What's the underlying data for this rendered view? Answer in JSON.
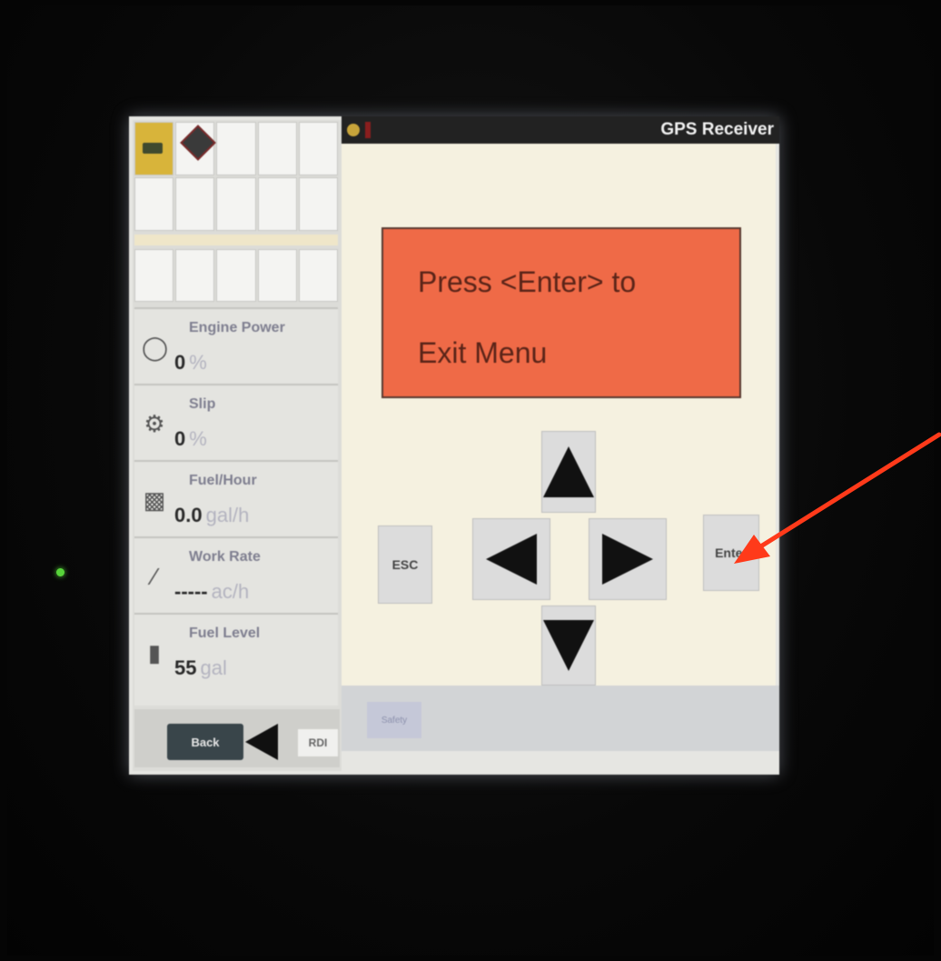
{
  "header": {
    "title": "GPS Receiver"
  },
  "message": {
    "line1": "Press <Enter> to",
    "line2": "Exit Menu"
  },
  "controls": {
    "esc_label": "ESC",
    "enter_label": "Enter"
  },
  "readouts": [
    {
      "label": "Engine Power",
      "value": "0",
      "unit": "%",
      "icon": "engine-icon"
    },
    {
      "label": "Slip",
      "value": "0",
      "unit": "%",
      "icon": "tractor-icon"
    },
    {
      "label": "Fuel/Hour",
      "value": "0.0",
      "unit": "gal/h",
      "icon": "fuel-pump-icon"
    },
    {
      "label": "Work Rate",
      "value": "-----",
      "unit": "ac/h",
      "icon": "work-rate-icon"
    },
    {
      "label": "Fuel Level",
      "value": "55",
      "unit": "gal",
      "icon": "fuel-level-icon"
    }
  ],
  "bottom": {
    "back_label": "Back",
    "rdi_label": "RDI",
    "safety_label": "Safety"
  },
  "colors": {
    "message_bg": "#ef6a47",
    "annotation_arrow": "#ff3a1a",
    "header_bg": "#222222"
  }
}
